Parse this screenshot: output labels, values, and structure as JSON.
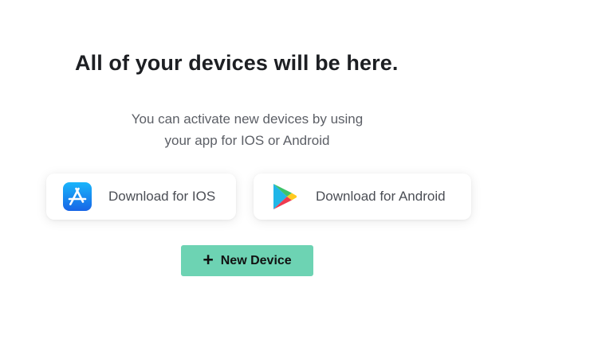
{
  "empty_state": {
    "title": "All of your devices will be here.",
    "description_line1": "You can activate new devices by using",
    "description_line2": "your app for IOS or Android"
  },
  "downloads": {
    "ios_label": "Download for IOS",
    "ios_icon": "app-store-icon",
    "android_label": "Download for Android",
    "android_icon": "google-play-icon"
  },
  "actions": {
    "new_device_label": "New Device",
    "new_device_icon": "plus-icon"
  },
  "colors": {
    "accent": "#6dd3b3",
    "app_store_blue": "#1c8bf0",
    "title": "#1d1f23",
    "body_text": "#5c5f66"
  }
}
